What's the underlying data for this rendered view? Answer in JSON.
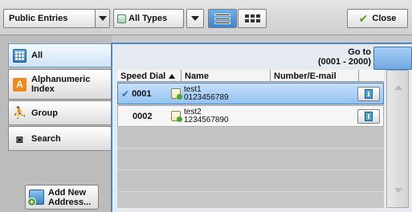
{
  "toolbar": {
    "entries_select": "Public Entries",
    "types_select": "All Types",
    "close_label": "Close"
  },
  "tabs": [
    {
      "label": "All",
      "icon": "grid-list-icon",
      "selected": true
    },
    {
      "label": "Alphanumeric Index",
      "icon": "letter-a-icon",
      "selected": false
    },
    {
      "label": "Group",
      "icon": "group-icon",
      "selected": false
    },
    {
      "label": "Search",
      "icon": "binoculars-icon",
      "selected": false
    }
  ],
  "add_new": {
    "line1": "Add New",
    "line2": "Address..."
  },
  "goto": {
    "line1": "Go to",
    "line2": "(0001 - 2000)"
  },
  "table": {
    "columns": [
      "Speed Dial",
      "Name",
      "Number/E-mail"
    ],
    "rows": [
      {
        "speed_dial": "0001",
        "name": "test1",
        "number": "0123456789",
        "selected": true
      },
      {
        "speed_dial": "0002",
        "name": "test2",
        "number": "1234567890",
        "selected": false
      }
    ]
  },
  "colors": {
    "accent": "#4f86c5",
    "selected_row": "#94c2f1",
    "close_check": "#56a12c"
  }
}
